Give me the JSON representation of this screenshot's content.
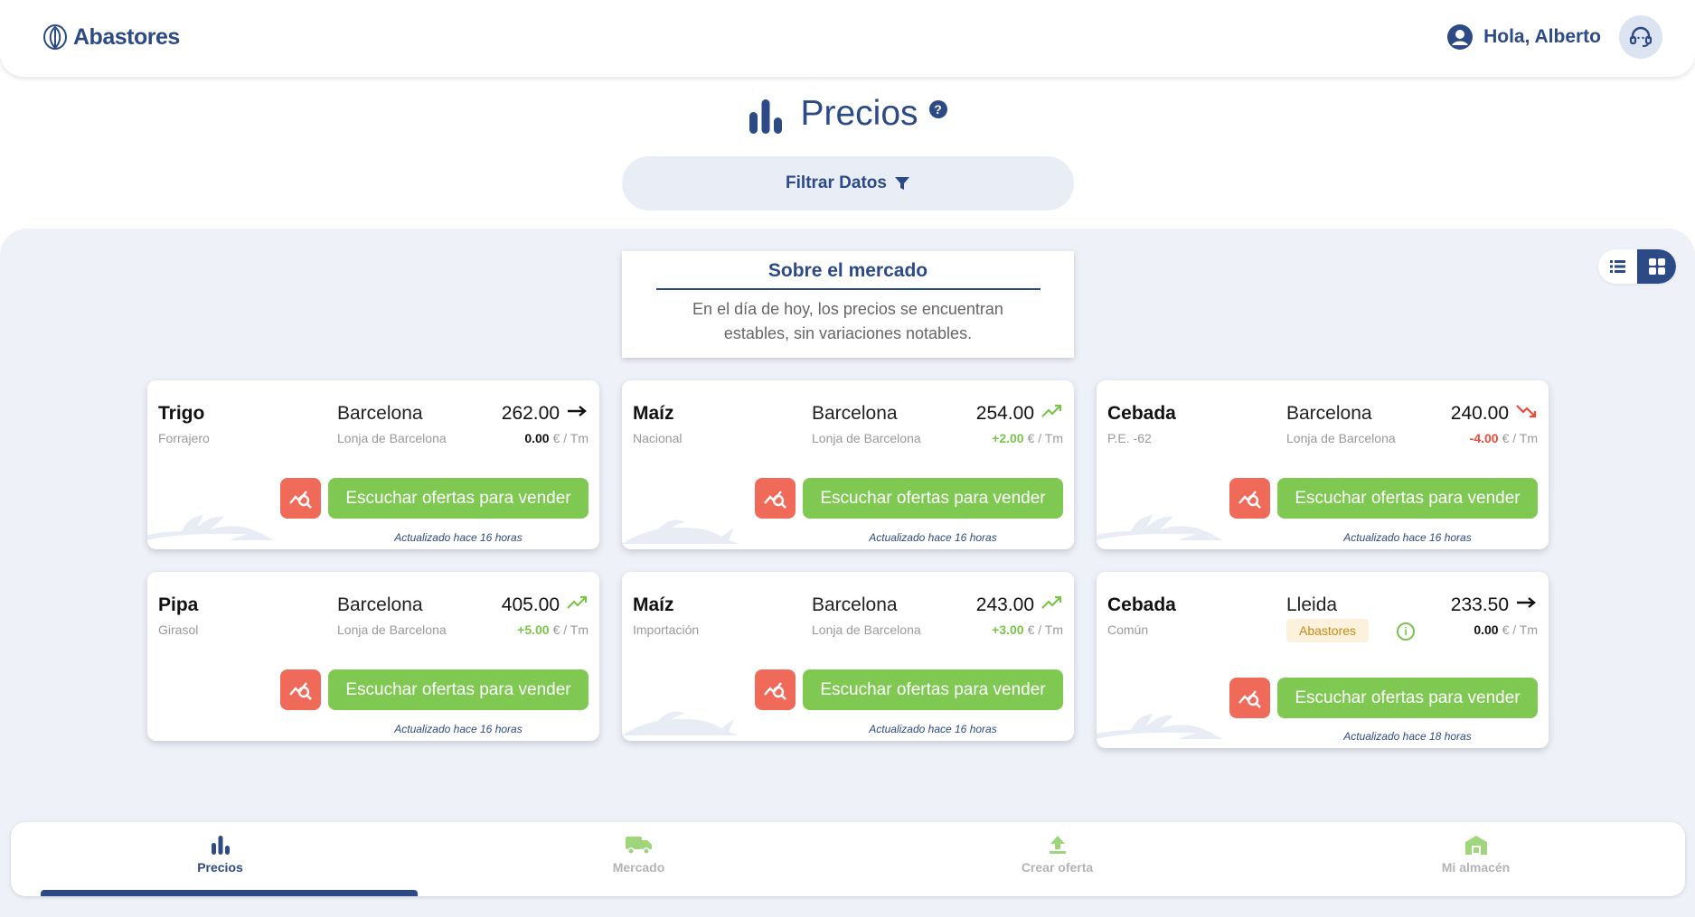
{
  "header": {
    "logo_text": "Abastores",
    "greeting": "Hola, Alberto"
  },
  "page": {
    "title": "Precios",
    "help_symbol": "?",
    "filter_label": "Filtrar Datos"
  },
  "market": {
    "title": "Sobre el mercado",
    "text": "En el día de hoy, los precios se encuentran estables, sin variaciones notables."
  },
  "cards": [
    {
      "name": "Trigo",
      "variety": "Forrajero",
      "city": "Barcelona",
      "lonja": "Lonja de Barcelona",
      "price": "262.00",
      "change": "0.00",
      "unit": "€ / Tm",
      "trend": "flat",
      "offer_label": "Escuchar ofertas para vender",
      "updated": "Actualizado hace 16 horas"
    },
    {
      "name": "Maíz",
      "variety": "Nacional",
      "city": "Barcelona",
      "lonja": "Lonja de Barcelona",
      "price": "254.00",
      "change": "+2.00",
      "unit": "€ / Tm",
      "trend": "up",
      "offer_label": "Escuchar ofertas para vender",
      "updated": "Actualizado hace 16 horas"
    },
    {
      "name": "Cebada",
      "variety": "P.E. -62",
      "city": "Barcelona",
      "lonja": "Lonja de Barcelona",
      "price": "240.00",
      "change": "-4.00",
      "unit": "€ / Tm",
      "trend": "down",
      "offer_label": "Escuchar ofertas para vender",
      "updated": "Actualizado hace 16 horas"
    },
    {
      "name": "Pipa",
      "variety": "Girasol",
      "city": "Barcelona",
      "lonja": "Lonja de Barcelona",
      "price": "405.00",
      "change": "+5.00",
      "unit": "€ / Tm",
      "trend": "up",
      "offer_label": "Escuchar ofertas para vender",
      "updated": "Actualizado hace 16 horas"
    },
    {
      "name": "Maíz",
      "variety": "Importación",
      "city": "Barcelona",
      "lonja": "Lonja de Barcelona",
      "price": "243.00",
      "change": "+3.00",
      "unit": "€ / Tm",
      "trend": "up",
      "offer_label": "Escuchar ofertas para vender",
      "updated": "Actualizado hace 16 horas"
    },
    {
      "name": "Cebada",
      "variety": "Común",
      "city": "Lleida",
      "badge": "Abastores",
      "info_symbol": "i",
      "price": "233.50",
      "change": "0.00",
      "unit": "€ / Tm",
      "trend": "flat",
      "offer_label": "Escuchar ofertas para vender",
      "updated": "Actualizado hace 18 horas"
    }
  ],
  "nav": {
    "items": [
      {
        "label": "Precios",
        "icon": "bar-chart-icon",
        "active": true
      },
      {
        "label": "Mercado",
        "icon": "truck-icon",
        "active": false
      },
      {
        "label": "Crear oferta",
        "icon": "upload-icon",
        "active": false
      },
      {
        "label": "Mi almacén",
        "icon": "warehouse-icon",
        "active": false
      }
    ]
  },
  "colors": {
    "brand": "#2c4a85",
    "offer_button": "#7fc852",
    "search_button": "#f06a5a",
    "up": "#7bc34a",
    "down": "#f04a3a",
    "background": "#eef1f8"
  }
}
